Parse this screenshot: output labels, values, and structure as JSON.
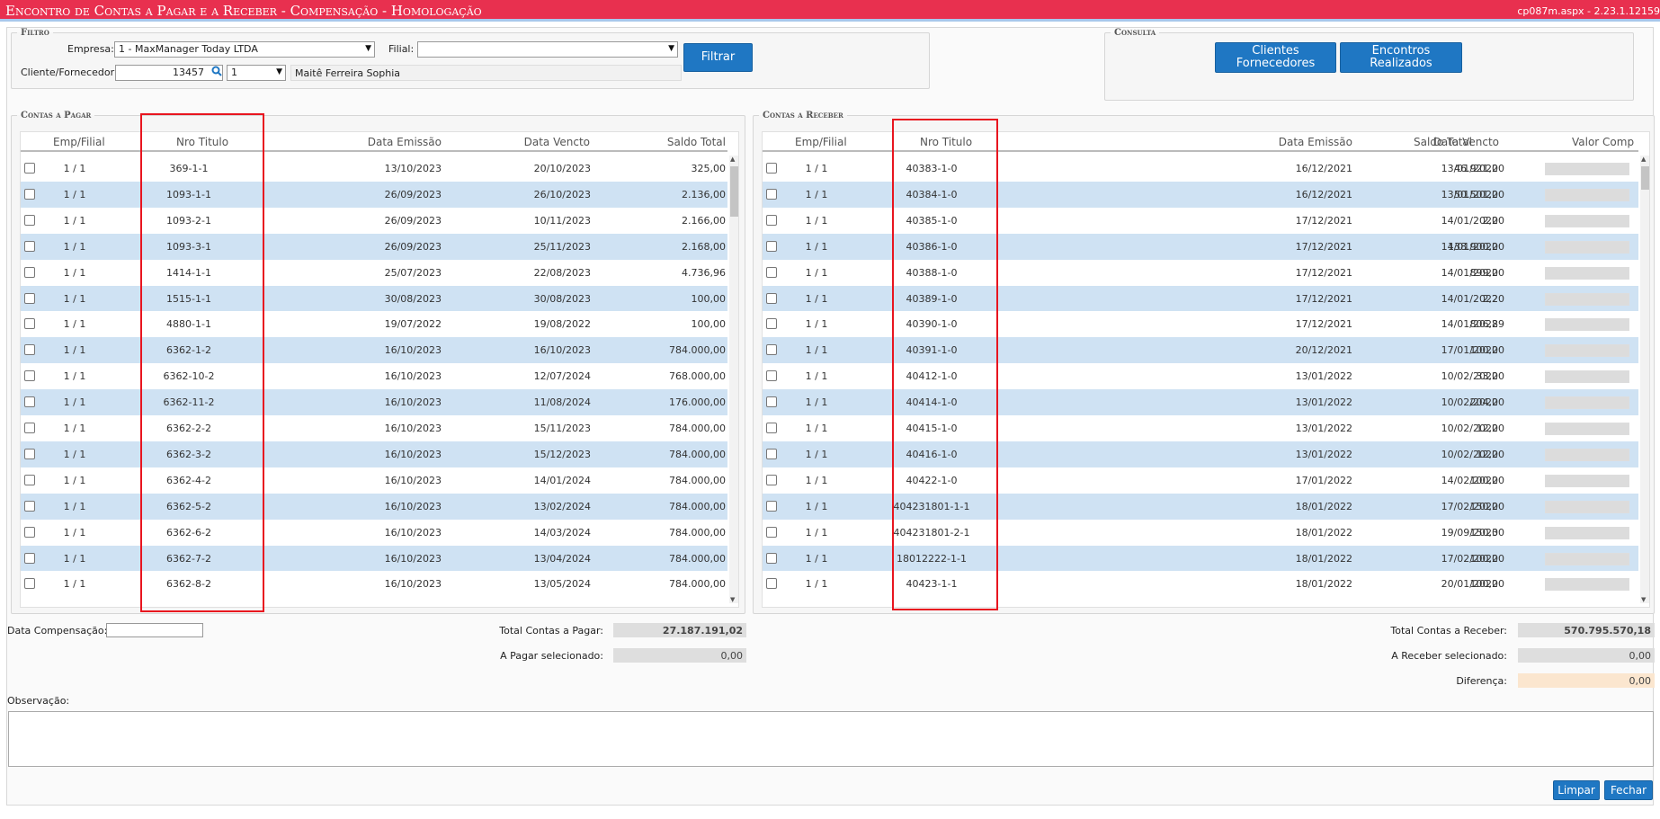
{
  "window": {
    "title": "Encontro de Contas a Pagar e a Receber - Compensação  - Homologação",
    "version": "cp087m.aspx - 2.23.1.12159"
  },
  "filtro": {
    "legend": "Filtro",
    "empresa_label": "Empresa:",
    "empresa_value": "1 - MaxManager Today LTDA",
    "filial_label": "Filial:",
    "filial_value": "",
    "cliente_label": "Cliente/Fornecedor:",
    "cliente_code": "13457",
    "cliente_seq": "1",
    "cliente_name": "Maitê Ferreira Sophia",
    "filtrar_button": "Filtrar"
  },
  "consulta": {
    "legend": "Consulta",
    "clientes_button_1": "Clientes",
    "clientes_button_2": "Fornecedores",
    "encontros_button_1": "Encontros",
    "encontros_button_2": "Realizados"
  },
  "pagar": {
    "legend": "Contas a Pagar",
    "columns": [
      "Emp/Filial",
      "Nro Titulo",
      "Data Emissão",
      "Data Vencto",
      "Saldo Total"
    ],
    "rows": [
      [
        "1 / 1",
        "369-1-1",
        "13/10/2023",
        "20/10/2023",
        "325,00"
      ],
      [
        "1 / 1",
        "1093-1-1",
        "26/09/2023",
        "26/10/2023",
        "2.136,00"
      ],
      [
        "1 / 1",
        "1093-2-1",
        "26/09/2023",
        "10/11/2023",
        "2.166,00"
      ],
      [
        "1 / 1",
        "1093-3-1",
        "26/09/2023",
        "25/11/2023",
        "2.168,00"
      ],
      [
        "1 / 1",
        "1414-1-1",
        "25/07/2023",
        "22/08/2023",
        "4.736,96"
      ],
      [
        "1 / 1",
        "1515-1-1",
        "30/08/2023",
        "30/08/2023",
        "100,00"
      ],
      [
        "1 / 1",
        "4880-1-1",
        "19/07/2022",
        "19/08/2022",
        "100,00"
      ],
      [
        "1 / 1",
        "6362-1-2",
        "16/10/2023",
        "16/10/2023",
        "784.000,00"
      ],
      [
        "1 / 1",
        "6362-10-2",
        "16/10/2023",
        "12/07/2024",
        "768.000,00"
      ],
      [
        "1 / 1",
        "6362-11-2",
        "16/10/2023",
        "11/08/2024",
        "176.000,00"
      ],
      [
        "1 / 1",
        "6362-2-2",
        "16/10/2023",
        "15/11/2023",
        "784.000,00"
      ],
      [
        "1 / 1",
        "6362-3-2",
        "16/10/2023",
        "15/12/2023",
        "784.000,00"
      ],
      [
        "1 / 1",
        "6362-4-2",
        "16/10/2023",
        "14/01/2024",
        "784.000,00"
      ],
      [
        "1 / 1",
        "6362-5-2",
        "16/10/2023",
        "13/02/2024",
        "784.000,00"
      ],
      [
        "1 / 1",
        "6362-6-2",
        "16/10/2023",
        "14/03/2024",
        "784.000,00"
      ],
      [
        "1 / 1",
        "6362-7-2",
        "16/10/2023",
        "13/04/2024",
        "784.000,00"
      ],
      [
        "1 / 1",
        "6362-8-2",
        "16/10/2023",
        "13/05/2024",
        "784.000,00"
      ]
    ]
  },
  "receber": {
    "legend": "Contas a Receber",
    "columns": [
      "Emp/Filial",
      "Nro Titulo",
      "Data Emissão",
      "Data Vencto",
      "Saldo Total",
      "Valor Comp"
    ],
    "rows": [
      [
        "1 / 1",
        "40383-1-0",
        "16/12/2021",
        "13/01/2022",
        "46.921,00"
      ],
      [
        "1 / 1",
        "40384-1-0",
        "16/12/2021",
        "13/01/2022",
        "50.501,00"
      ],
      [
        "1 / 1",
        "40385-1-0",
        "17/12/2021",
        "14/01/2022",
        "2,00"
      ],
      [
        "1 / 1",
        "40386-1-0",
        "17/12/2021",
        "14/01/2022",
        "138.900,00"
      ],
      [
        "1 / 1",
        "40388-1-0",
        "17/12/2021",
        "14/01/2022",
        "899,00"
      ],
      [
        "1 / 1",
        "40389-1-0",
        "17/12/2021",
        "14/01/2022",
        "2,20"
      ],
      [
        "1 / 1",
        "40390-1-0",
        "17/12/2021",
        "14/01/2022",
        "806,89"
      ],
      [
        "1 / 1",
        "40391-1-0",
        "20/12/2021",
        "17/01/2022",
        "100,00"
      ],
      [
        "1 / 1",
        "40412-1-0",
        "13/01/2022",
        "10/02/2022",
        "33,00"
      ],
      [
        "1 / 1",
        "40414-1-0",
        "13/01/2022",
        "10/02/2022",
        "204,00"
      ],
      [
        "1 / 1",
        "40415-1-0",
        "13/01/2022",
        "10/02/2022",
        "12,00"
      ],
      [
        "1 / 1",
        "40416-1-0",
        "13/01/2022",
        "10/02/2022",
        "12,00"
      ],
      [
        "1 / 1",
        "40422-1-0",
        "17/01/2022",
        "14/02/2022",
        "100,00"
      ],
      [
        "1 / 1",
        "404231801-1-1",
        "18/01/2022",
        "17/02/2022",
        "150,00"
      ],
      [
        "1 / 1",
        "404231801-2-1",
        "18/01/2022",
        "19/09/2023",
        "150,00"
      ],
      [
        "1 / 1",
        "18012222-1-1",
        "18/01/2022",
        "17/02/2022",
        "100,00"
      ],
      [
        "1 / 1",
        "40423-1-1",
        "18/01/2022",
        "20/01/2022",
        "100,00"
      ]
    ]
  },
  "totals": {
    "data_comp_label": "Data Compensação:",
    "data_comp_value": "",
    "total_pagar_label": "Total Contas a Pagar:",
    "total_pagar_value": "27.187.191,02",
    "pagar_sel_label": "A Pagar selecionado:",
    "pagar_sel_value": "0,00",
    "total_receber_label": "Total Contas a Receber:",
    "total_receber_value": "570.795.570,18",
    "receber_sel_label": "A Receber selecionado:",
    "receber_sel_value": "0,00",
    "diferenca_label": "Diferença:",
    "diferenca_value": "0,00"
  },
  "observacao": {
    "label": "Observação:",
    "value": ""
  },
  "actions": {
    "limpar": "Limpar",
    "fechar": "Fechar"
  },
  "colors": {
    "title_bar": "#e8304f",
    "button": "#1f77c3",
    "row_alt": "#cfe2f3",
    "highlight_box": "#e8151f",
    "diferenca_bg": "#fbe6cf"
  }
}
